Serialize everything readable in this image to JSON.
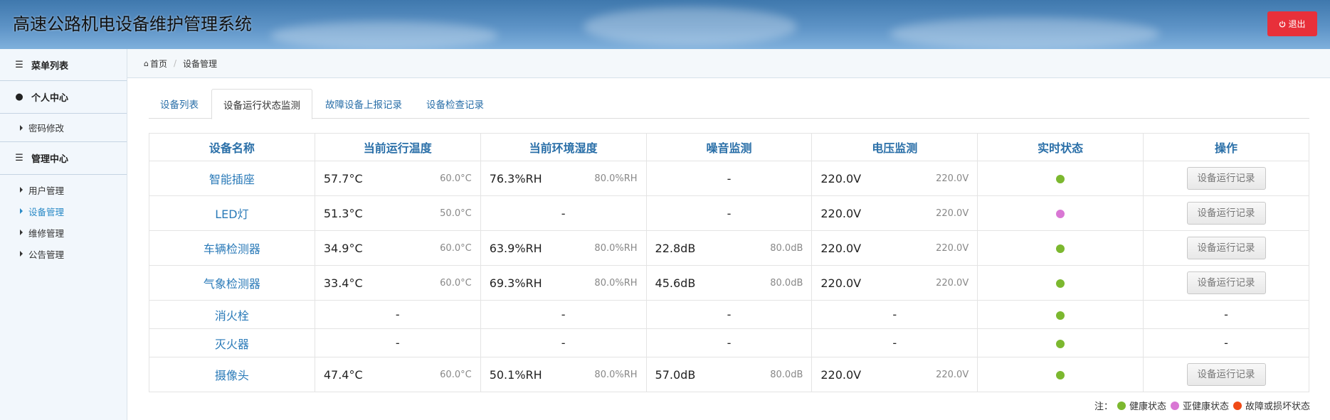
{
  "app": {
    "title": "高速公路机电设备维护管理系统",
    "logout_label": "退出"
  },
  "sidebar": {
    "menu_list": "菜单列表",
    "personal_center": "个人中心",
    "password_change": "密码修改",
    "management_center": "管理中心",
    "items": [
      {
        "label": "用户管理",
        "active": false
      },
      {
        "label": "设备管理",
        "active": true
      },
      {
        "label": "维修管理",
        "active": false
      },
      {
        "label": "公告管理",
        "active": false
      }
    ]
  },
  "breadcrumb": {
    "home": "首页",
    "current": "设备管理"
  },
  "tabs": [
    {
      "label": "设备列表",
      "active": false
    },
    {
      "label": "设备运行状态监测",
      "active": true
    },
    {
      "label": "故障设备上报记录",
      "active": false
    },
    {
      "label": "设备检查记录",
      "active": false
    }
  ],
  "table": {
    "headers": [
      "设备名称",
      "当前运行温度",
      "当前环境湿度",
      "噪音监测",
      "电压监测",
      "实时状态",
      "操作"
    ],
    "button_label": "设备运行记录",
    "dash": "-",
    "rows": [
      {
        "name": "智能插座",
        "temp": "57.7°C",
        "temp_limit": "60.0°C",
        "hum": "76.3%RH",
        "hum_limit": "80.0%RH",
        "noise": "-",
        "noise_limit": "",
        "volt": "220.0V",
        "volt_limit": "220.0V",
        "status": "healthy",
        "op": "button"
      },
      {
        "name": "LED灯",
        "temp": "51.3°C",
        "temp_limit": "50.0°C",
        "hum": "-",
        "hum_limit": "",
        "noise": "-",
        "noise_limit": "",
        "volt": "220.0V",
        "volt_limit": "220.0V",
        "status": "subhealthy",
        "op": "button"
      },
      {
        "name": "车辆检测器",
        "temp": "34.9°C",
        "temp_limit": "60.0°C",
        "hum": "63.9%RH",
        "hum_limit": "80.0%RH",
        "noise": "22.8dB",
        "noise_limit": "80.0dB",
        "volt": "220.0V",
        "volt_limit": "220.0V",
        "status": "healthy",
        "op": "button"
      },
      {
        "name": "气象检测器",
        "temp": "33.4°C",
        "temp_limit": "60.0°C",
        "hum": "69.3%RH",
        "hum_limit": "80.0%RH",
        "noise": "45.6dB",
        "noise_limit": "80.0dB",
        "volt": "220.0V",
        "volt_limit": "220.0V",
        "status": "healthy",
        "op": "button"
      },
      {
        "name": "消火栓",
        "temp": "-",
        "temp_limit": "",
        "hum": "-",
        "hum_limit": "",
        "noise": "-",
        "noise_limit": "",
        "volt": "-",
        "volt_limit": "",
        "status": "healthy",
        "op": "-"
      },
      {
        "name": "灭火器",
        "temp": "-",
        "temp_limit": "",
        "hum": "-",
        "hum_limit": "",
        "noise": "-",
        "noise_limit": "",
        "volt": "-",
        "volt_limit": "",
        "status": "healthy",
        "op": "-"
      },
      {
        "name": "摄像头",
        "temp": "47.4°C",
        "temp_limit": "60.0°C",
        "hum": "50.1%RH",
        "hum_limit": "80.0%RH",
        "noise": "57.0dB",
        "noise_limit": "80.0dB",
        "volt": "220.0V",
        "volt_limit": "220.0V",
        "status": "healthy",
        "op": "button"
      }
    ]
  },
  "legend": {
    "prefix": "注：",
    "items": [
      {
        "label": "健康状态",
        "color": "#7cb82f"
      },
      {
        "label": "亚健康状态",
        "color": "#d977d4"
      },
      {
        "label": "故障或损坏状态",
        "color": "#f04a16"
      }
    ]
  },
  "status_colors": {
    "healthy": "#7cb82f",
    "subhealthy": "#d977d4",
    "fault": "#f04a16"
  }
}
